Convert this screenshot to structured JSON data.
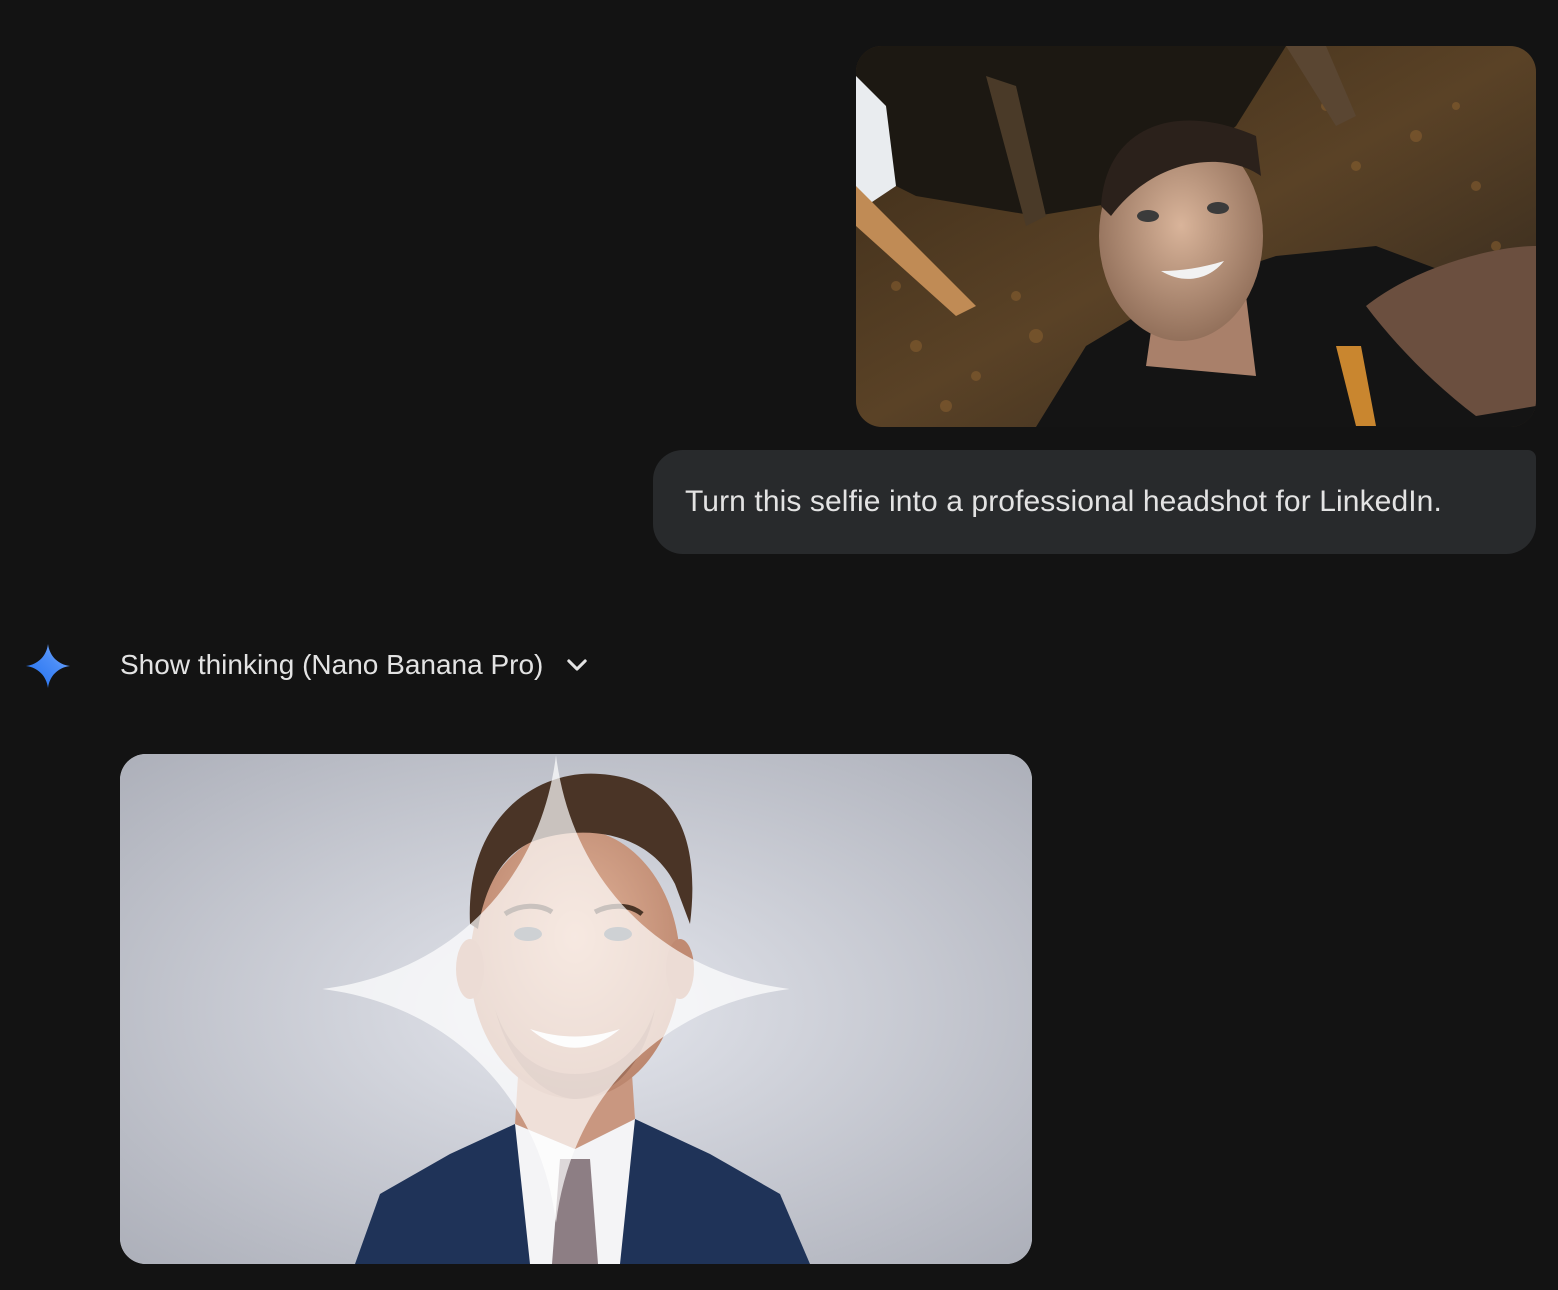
{
  "conversation": {
    "user_message": {
      "image_label": "selfie photo",
      "text": "Turn this selfie into a professional headshot for LinkedIn."
    },
    "model_response": {
      "logo_icon": "gemini-spark-icon",
      "thinking_toggle_label": "Show thinking (Nano Banana Pro)",
      "toggle_icon": "chevron-down-icon",
      "image_label": "generated professional headshot",
      "watermark_icon": "sparkle-watermark-icon"
    }
  },
  "colors": {
    "background": "#131313",
    "bubble": "#282a2c",
    "text": "#e3e3e3",
    "spark_blue": "#4285f4"
  }
}
